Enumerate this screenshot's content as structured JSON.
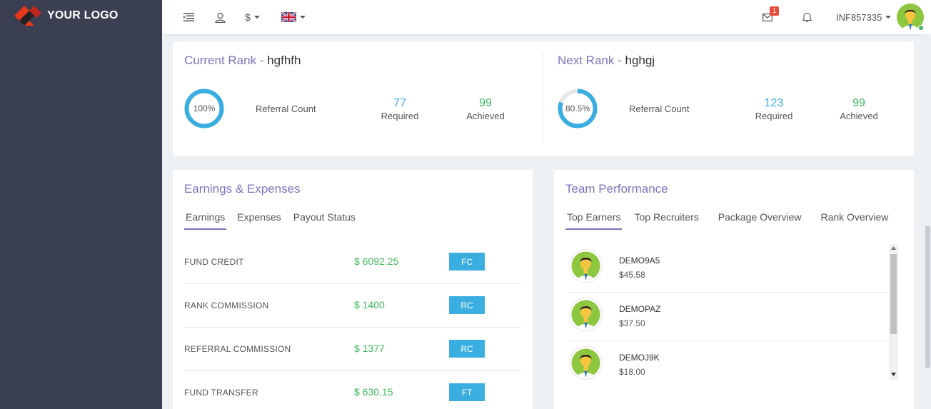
{
  "brand": {
    "logo_text": "YOUR LOGO",
    "accent": "#7f73bf",
    "sidebar_bg": "#3a3f51"
  },
  "topbar": {
    "currency": "$",
    "language_flag": "uk-flag-icon",
    "mail_badge": "1",
    "user_id": "INF857335"
  },
  "rank": {
    "current": {
      "title": "Current Rank - ",
      "name": "hgfhfh",
      "percent_label": "100%",
      "progress": 1.0,
      "metric": "Referral Count",
      "required_value": "77",
      "required_label": "Required",
      "achieved_value": "99",
      "achieved_label": "Achieved"
    },
    "next": {
      "title": "Next Rank - ",
      "name": "hghgj",
      "percent_label": "80.5%",
      "progress": 0.805,
      "metric": "Referral Count",
      "required_value": "123",
      "required_label": "Required",
      "achieved_value": "99",
      "achieved_label": "Achieved"
    }
  },
  "earnings": {
    "title": "Earnings & Expenses",
    "tabs": [
      "Earnings",
      "Expenses",
      "Payout Status"
    ],
    "rows": [
      {
        "name": "FUND CREDIT",
        "amount": "$ 6092.25",
        "code": "FC"
      },
      {
        "name": "RANK COMMISSION",
        "amount": "$ 1400",
        "code": "RC"
      },
      {
        "name": "REFERRAL COMMISSION",
        "amount": "$ 1377",
        "code": "RC"
      },
      {
        "name": "FUND TRANSFER",
        "amount": "$ 630.15",
        "code": "FT"
      }
    ]
  },
  "team": {
    "title": "Team Performance",
    "tabs": [
      "Top Earners",
      "Top Recruiters",
      "Package Overview",
      "Rank Overview"
    ],
    "members": [
      {
        "name": "DEMO9A5",
        "amount": "$45.58"
      },
      {
        "name": "DEMOPAZ",
        "amount": "$37.50"
      },
      {
        "name": "DEMOJ9K",
        "amount": "$18.00"
      }
    ]
  }
}
